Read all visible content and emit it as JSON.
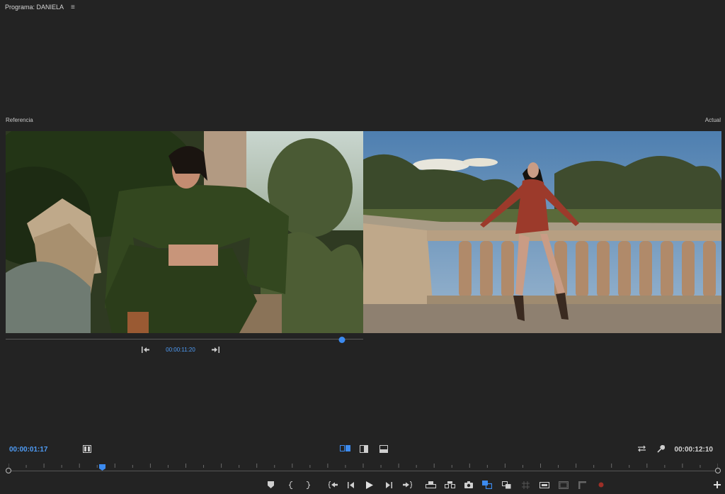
{
  "panel": {
    "title": "Programa: DANIELA",
    "menu_icon": "hamburger-menu-icon"
  },
  "reference": {
    "label": "Referencia",
    "timecode": "00:00:11:20",
    "scrub_position": 0.94
  },
  "current": {
    "label": "Actual"
  },
  "playback": {
    "current_timecode": "00:00:01:17",
    "duration_timecode": "00:00:12:10",
    "playhead_position": 0.132
  },
  "colors": {
    "accent": "#3c8bf0",
    "timecode_blue": "#4f9cf6",
    "background": "#232323",
    "record": "#c0392b"
  },
  "icons": {
    "lower_left": "comparison-view-icon",
    "view_modes": [
      "side-by-side-icon",
      "vertical-split-icon",
      "horizontal-split-icon"
    ],
    "lower_right": [
      "swap-sides-icon",
      "wrench-settings-icon"
    ],
    "transport": [
      "add-marker-icon",
      "mark-in-icon",
      "mark-out-icon",
      "go-to-in-icon",
      "step-back-icon",
      "play-icon",
      "step-forward-icon",
      "go-to-out-icon",
      "lift-icon",
      "extract-icon",
      "export-frame-icon",
      "comparison-view-toggle-icon",
      "multi-camera-icon",
      "safe-margins-icon",
      "insert-icon",
      "overlay-icon",
      "trim-monitor-icon",
      "record-icon",
      "add-button-icon"
    ]
  }
}
